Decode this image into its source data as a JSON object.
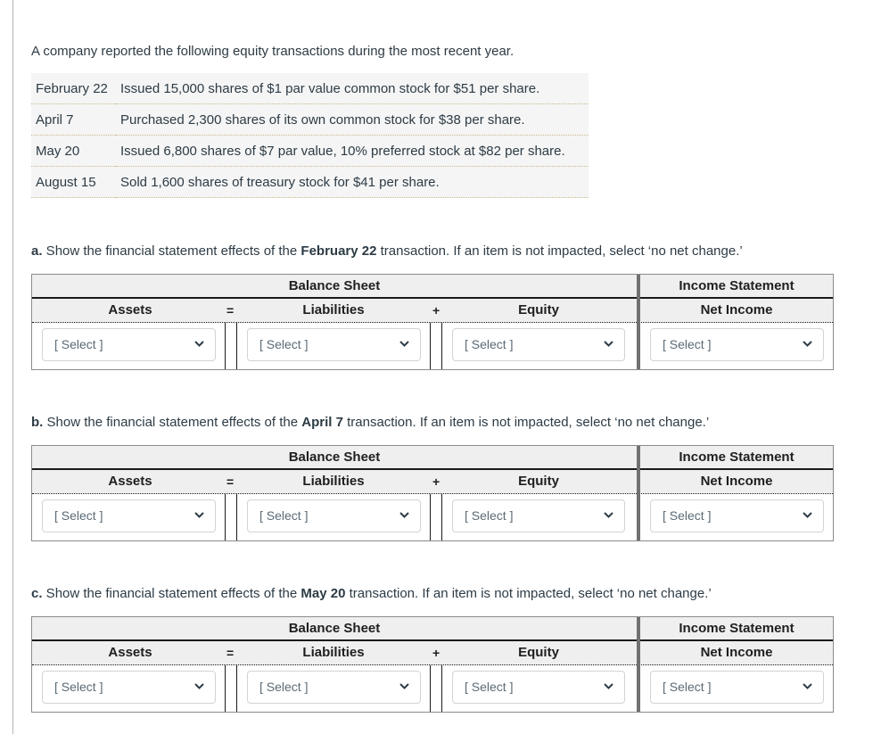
{
  "intro": "A company reported the following equity transactions during the most recent year.",
  "transactions": [
    {
      "date": "February 22",
      "description": "Issued 15,000 shares of $1 par value common stock for $51 per share."
    },
    {
      "date": "April 7",
      "description": "Purchased 2,300 shares of its own common stock for $38 per share."
    },
    {
      "date": "May 20",
      "description": "Issued 6,800 shares of $7 par value, 10% preferred stock at $82 per share."
    },
    {
      "date": "August 15",
      "description": "Sold 1,600 shares of treasury stock for $41 per share."
    }
  ],
  "headers": {
    "balance_sheet": "Balance Sheet",
    "income_statement": "Income Statement",
    "assets": "Assets",
    "liabilities": "Liabilities",
    "equity": "Equity",
    "net_income": "Net Income",
    "equals": "=",
    "plus": "+"
  },
  "questions": [
    {
      "letter": "a.",
      "prefix": " Show the financial statement effects of the ",
      "date": "February 22",
      "suffix": " transaction. If an item is not impacted, select ‘no net change.’",
      "selects": {
        "assets": "[ Select ]",
        "liabilities": "[ Select ]",
        "equity": "[ Select ]",
        "net_income": "[ Select ]"
      }
    },
    {
      "letter": "b.",
      "prefix": " Show the financial statement effects of the ",
      "date": "April 7",
      "suffix": " transaction. If an item is not impacted, select ‘no net change.’",
      "selects": {
        "assets": "[ Select ]",
        "liabilities": "[ Select ]",
        "equity": "[ Select ]",
        "net_income": "[ Select ]"
      }
    },
    {
      "letter": "c.",
      "prefix": " Show the financial statement effects of the ",
      "date": "May 20",
      "suffix": " transaction. If an item is not impacted, select ‘no net change.’",
      "selects": {
        "assets": "[ Select ]",
        "liabilities": "[ Select ]",
        "equity": "[ Select ]",
        "net_income": "[ Select ]"
      }
    }
  ]
}
